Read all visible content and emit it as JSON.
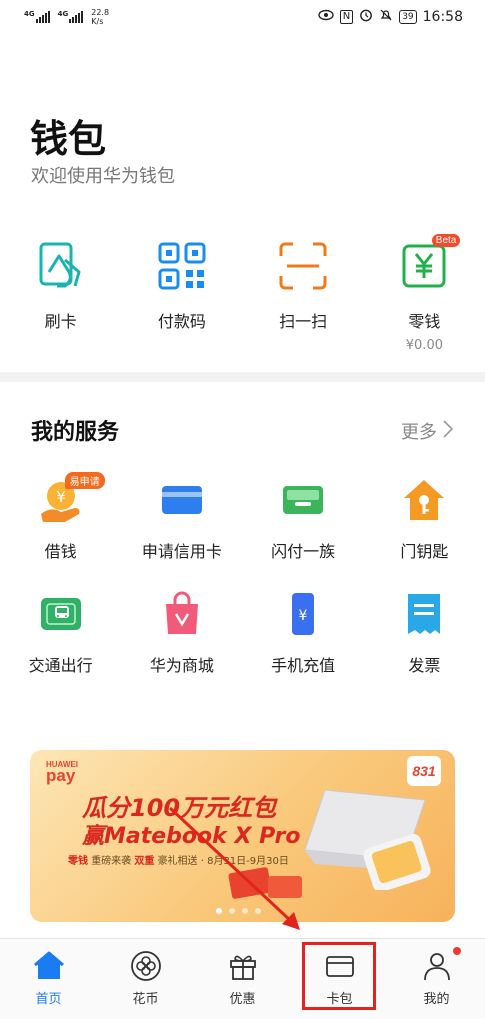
{
  "status_bar": {
    "signal1": "4G",
    "signal2": "4G",
    "speed_value": "22.8",
    "speed_unit": "K/s",
    "nfc": "N",
    "battery": "39",
    "time": "16:58"
  },
  "header": {
    "title": "钱包",
    "subtitle": "欢迎使用华为钱包"
  },
  "quick_actions": [
    {
      "label": "刷卡",
      "icon": "card-swipe-icon"
    },
    {
      "label": "付款码",
      "icon": "qr-code-icon"
    },
    {
      "label": "扫一扫",
      "icon": "scan-icon"
    },
    {
      "label": "零钱",
      "icon": "change-wallet-icon",
      "badge": "Beta",
      "sub": "¥0.00"
    }
  ],
  "services": {
    "title": "我的服务",
    "more": "更多",
    "items": [
      {
        "label": "借钱",
        "icon": "loan-icon",
        "tag": "易申请"
      },
      {
        "label": "申请信用卡",
        "icon": "credit-card-icon"
      },
      {
        "label": "闪付一族",
        "icon": "quickpay-icon"
      },
      {
        "label": "门钥匙",
        "icon": "door-key-icon"
      },
      {
        "label": "交通出行",
        "icon": "transit-card-icon"
      },
      {
        "label": "华为商城",
        "icon": "shopping-bag-icon"
      },
      {
        "label": "手机充值",
        "icon": "phone-topup-icon"
      },
      {
        "label": "发票",
        "icon": "invoice-icon"
      }
    ]
  },
  "banner": {
    "brand_top": "HUAWEI",
    "brand": "pay",
    "line1": "瓜分100万元红包",
    "line2": "赢Matebook X Pro",
    "line3_a": "零钱",
    "line3_b": "重磅来袭",
    "line3_c": "双重",
    "line3_d": "豪礼相送 · 8月31日-9月30日",
    "badge": "831"
  },
  "tabs": [
    {
      "label": "首页",
      "icon": "home-icon",
      "active": true
    },
    {
      "label": "花币",
      "icon": "coin-icon"
    },
    {
      "label": "优惠",
      "icon": "gift-icon"
    },
    {
      "label": "卡包",
      "icon": "card-wallet-icon"
    },
    {
      "label": "我的",
      "icon": "profile-icon"
    }
  ],
  "colors": {
    "accent": "#1a7cf0",
    "highlight": "#e2241c"
  }
}
